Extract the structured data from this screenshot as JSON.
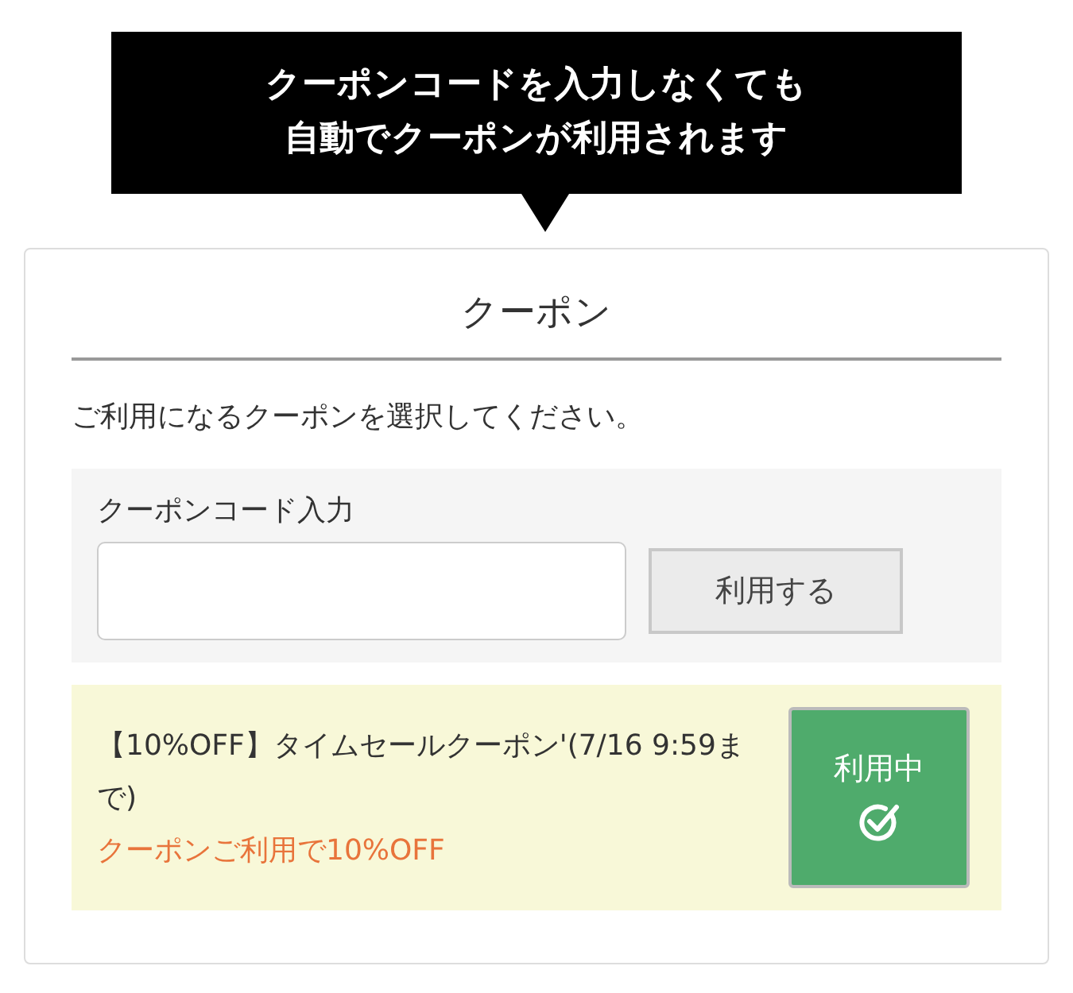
{
  "tooltip": {
    "lines": [
      "クーポンコードを入力しなくても",
      "自動でクーポンが利用されます"
    ]
  },
  "card": {
    "title": "クーポン",
    "instruction": "ご利用になるクーポンを選択してください。"
  },
  "code_entry": {
    "label": "クーポンコード入力",
    "button": "利用する"
  },
  "coupons": [
    {
      "title": "【10%OFF】タイムセールクーポン'(7/16 9:59まで)",
      "discount": "クーポンご利用で10%OFF",
      "button": "利用中",
      "applied": true
    }
  ]
}
